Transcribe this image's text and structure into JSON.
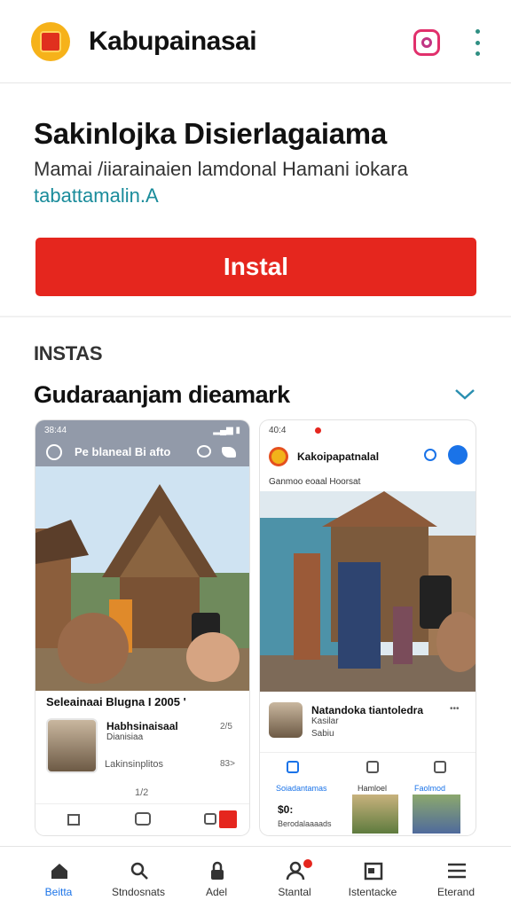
{
  "header": {
    "app_name": "Kabupainasai",
    "icons": [
      "app-logo-icon",
      "instagram-icon",
      "more-vertical-icon"
    ]
  },
  "hero": {
    "title": "Sakinlojka Disierlagaiama",
    "description": "Mamai /iiarainaien lamdonal Hamani iokara",
    "link": "tabattamalin.A",
    "install_label": "Instal"
  },
  "section": {
    "label": "INSTAS",
    "title": "Gudaraanjam dieamark",
    "chevron_icon": "chevron-down-icon"
  },
  "screenshot_a": {
    "status_time": "38:44",
    "topbar_title": "Pe blaneal Bi afto",
    "caption": "Seleainaai Blugna I 2005 '",
    "user_name": "Habhsinaisaal",
    "user_sub": "Dianisiaa",
    "time": "2/5",
    "stat_label": "Lakinsinplitos",
    "stat_value": "83>",
    "page_indicator": "1/2"
  },
  "screenshot_b": {
    "status_time": "40:4",
    "app_title": "Kakoipapatnalal",
    "breadcrumb": "Ganmoo eoaal Hoorsat",
    "user_name": "Natandoka tiantoledra",
    "user_sub": "Kasilar",
    "user_sub2": "Sabiu",
    "dots": "•••",
    "nav": [
      "Soiadantamas",
      "Hamloel",
      "Faolmod"
    ],
    "price": "$0:",
    "price_sub": "Berodalaaaads"
  },
  "bottom_nav": {
    "tabs": [
      {
        "label": "Beitta",
        "icon": "home-icon",
        "active": true
      },
      {
        "label": "Stndosnats",
        "icon": "search-icon",
        "active": false
      },
      {
        "label": "Adel",
        "icon": "lock-icon",
        "active": false
      },
      {
        "label": "Stantal",
        "icon": "user-icon",
        "active": false
      },
      {
        "label": "Istentacke",
        "icon": "calendar-icon",
        "active": false
      },
      {
        "label": "Eterand",
        "icon": "menu-icon",
        "active": false
      }
    ]
  },
  "colors": {
    "accent": "#e5261e",
    "link": "#1a8c9b",
    "active_tab": "#1a73e8"
  }
}
